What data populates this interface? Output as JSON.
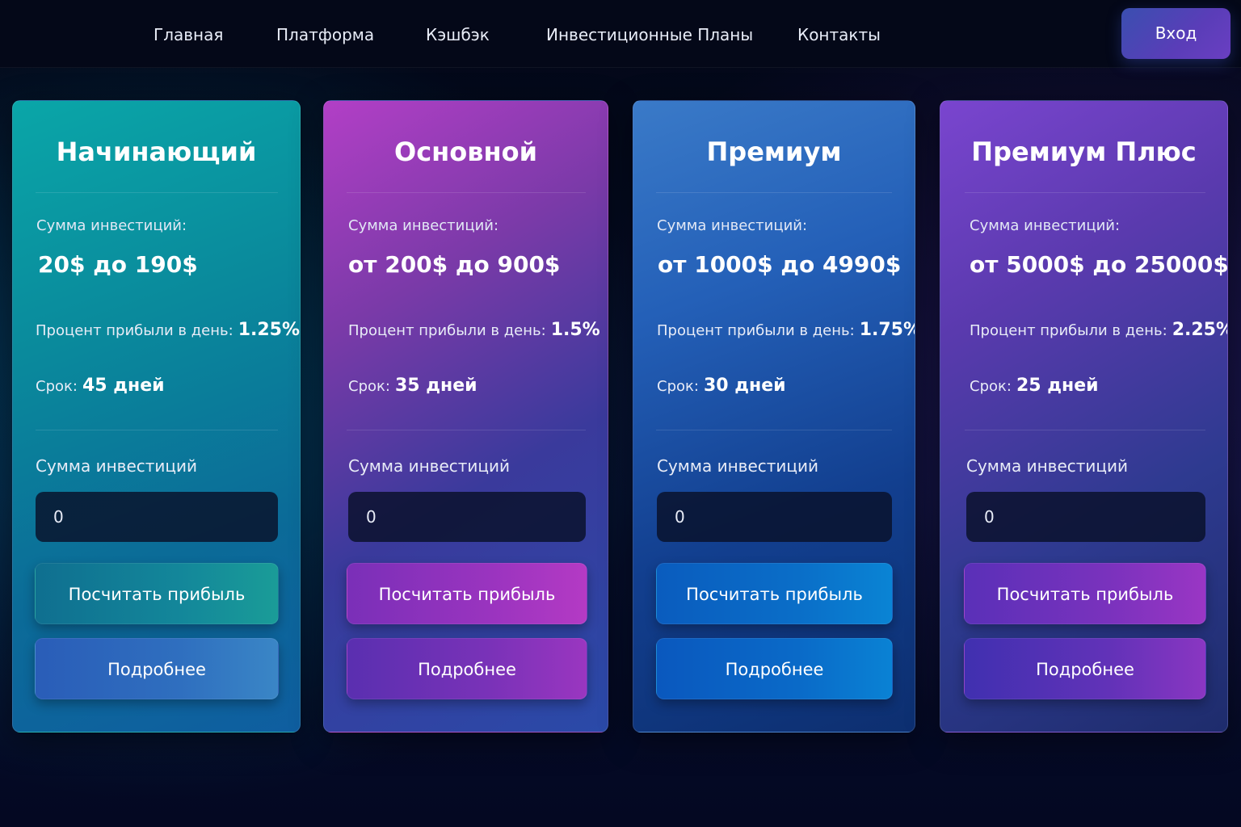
{
  "nav": {
    "items": [
      "Главная",
      "Платформа",
      "Кэшбэк",
      "Инвестиционные Планы",
      "Контакты"
    ],
    "login_label": "Вход"
  },
  "plans": [
    {
      "title": "Начинающий",
      "amount_label": "Сумма инвестиций:",
      "amount_range": "20$ до 190$",
      "profit_label": "Процент прибыли в день:",
      "profit_value": "1.25%",
      "term_label": "Срок:",
      "term_value": "45 дней",
      "input_label": "Сумма инвестиций",
      "input_value": "0",
      "calc_label": "Посчитать прибыль",
      "details_label": "Подробнее"
    },
    {
      "title": "Основной",
      "amount_label": "Сумма инвестиций:",
      "amount_range": "от 200$ до 900$",
      "profit_label": "Процент прибыли в день:",
      "profit_value": "1.5%",
      "term_label": "Срок:",
      "term_value": "35 дней",
      "input_label": "Сумма инвестиций",
      "input_value": "0",
      "calc_label": "Посчитать прибыль",
      "details_label": "Подробнее"
    },
    {
      "title": "Премиум",
      "amount_label": "Сумма инвестиций:",
      "amount_range": "от 1000$ до 4990$",
      "profit_label": "Процент прибыли в день:",
      "profit_value": "1.75%",
      "term_label": "Срок:",
      "term_value": "30 дней",
      "input_label": "Сумма инвестиций",
      "input_value": "0",
      "calc_label": "Посчитать прибыль",
      "details_label": "Подробнее"
    },
    {
      "title": "Премиум Плюс",
      "amount_label": "Сумма инвестиций:",
      "amount_range": "от 5000$ до 25000$",
      "profit_label": "Процент прибыли в день:",
      "profit_value": "2.25%",
      "term_label": "Срок:",
      "term_value": "25 дней",
      "input_label": "Сумма инвестиций",
      "input_value": "0",
      "calc_label": "Посчитать прибыль",
      "details_label": "Подробнее"
    }
  ],
  "colors": {
    "page_bg": "#04071a",
    "starter_card": "#0aa6a8",
    "basic_card": "#b23fc6",
    "premium_card": "#2f6cc4",
    "premium_plus_card": "#7a45cf"
  }
}
